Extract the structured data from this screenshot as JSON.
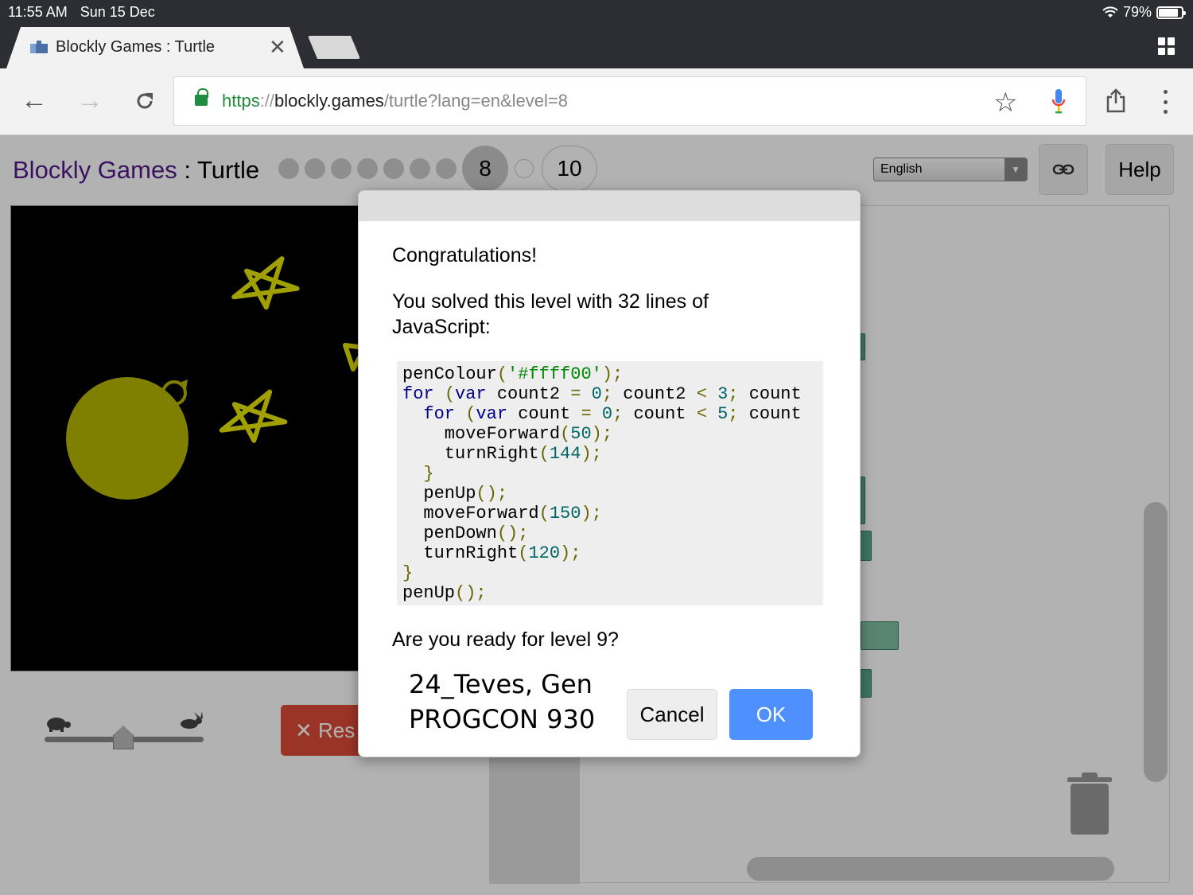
{
  "status_bar": {
    "time": "11:55 AM",
    "date": "Sun 15 Dec",
    "battery": "79%"
  },
  "browser": {
    "tab_title": "Blockly Games : Turtle",
    "url": {
      "scheme": "https",
      "separator": "://",
      "host": "blockly.games",
      "path": "/turtle?lang=en&level=8"
    }
  },
  "header": {
    "brand": "Blockly Games",
    "separator": " : ",
    "app": "Turtle",
    "current_level": "8",
    "last_level": "10",
    "language": "English",
    "help_label": "Help"
  },
  "controls": {
    "reset_label": "Res"
  },
  "dialog": {
    "heading": "Congratulations!",
    "message": "You solved this level with 32 lines of JavaScript:",
    "code": [
      [
        [
          "pln",
          "penColour"
        ],
        [
          "pun",
          "("
        ],
        [
          "str",
          "'#ffff00'"
        ],
        [
          "pun",
          ");"
        ]
      ],
      [
        [
          "kw",
          "for"
        ],
        [
          "pln",
          " "
        ],
        [
          "pun",
          "("
        ],
        [
          "kw",
          "var"
        ],
        [
          "pln",
          " count2 "
        ],
        [
          "pun",
          "="
        ],
        [
          "pln",
          " "
        ],
        [
          "num",
          "0"
        ],
        [
          "pun",
          ";"
        ],
        [
          "pln",
          " count2 "
        ],
        [
          "pun",
          "<"
        ],
        [
          "pln",
          " "
        ],
        [
          "num",
          "3"
        ],
        [
          "pun",
          ";"
        ],
        [
          "pln",
          " count"
        ]
      ],
      [
        [
          "pln",
          "  "
        ],
        [
          "kw",
          "for"
        ],
        [
          "pln",
          " "
        ],
        [
          "pun",
          "("
        ],
        [
          "kw",
          "var"
        ],
        [
          "pln",
          " count "
        ],
        [
          "pun",
          "="
        ],
        [
          "pln",
          " "
        ],
        [
          "num",
          "0"
        ],
        [
          "pun",
          ";"
        ],
        [
          "pln",
          " count "
        ],
        [
          "pun",
          "<"
        ],
        [
          "pln",
          " "
        ],
        [
          "num",
          "5"
        ],
        [
          "pun",
          ";"
        ],
        [
          "pln",
          " count"
        ]
      ],
      [
        [
          "pln",
          "    moveForward"
        ],
        [
          "pun",
          "("
        ],
        [
          "num",
          "50"
        ],
        [
          "pun",
          ");"
        ]
      ],
      [
        [
          "pln",
          "    turnRight"
        ],
        [
          "pun",
          "("
        ],
        [
          "num",
          "144"
        ],
        [
          "pun",
          ");"
        ]
      ],
      [
        [
          "pln",
          "  "
        ],
        [
          "pun",
          "}"
        ]
      ],
      [
        [
          "pln",
          "  penUp"
        ],
        [
          "pun",
          "();"
        ]
      ],
      [
        [
          "pln",
          "  moveForward"
        ],
        [
          "pun",
          "("
        ],
        [
          "num",
          "150"
        ],
        [
          "pun",
          ");"
        ]
      ],
      [
        [
          "pln",
          "  penDown"
        ],
        [
          "pun",
          "();"
        ]
      ],
      [
        [
          "pln",
          "  turnRight"
        ],
        [
          "pun",
          "("
        ],
        [
          "num",
          "120"
        ],
        [
          "pun",
          ");"
        ]
      ],
      [
        [
          "pun",
          "}"
        ]
      ],
      [
        [
          "pln",
          "penUp"
        ],
        [
          "pun",
          "();"
        ]
      ]
    ],
    "question": "Are you ready for level 9?",
    "overlay_line1": "24_Teves, Gen",
    "overlay_line2": "PROGCON 930",
    "cancel_label": "Cancel",
    "ok_label": "OK"
  },
  "colors": {
    "turtle_ink": "#ffff00",
    "ok_button": "#4d90fe",
    "reset_button": "#dd4b39",
    "brand": "#551a8b"
  }
}
